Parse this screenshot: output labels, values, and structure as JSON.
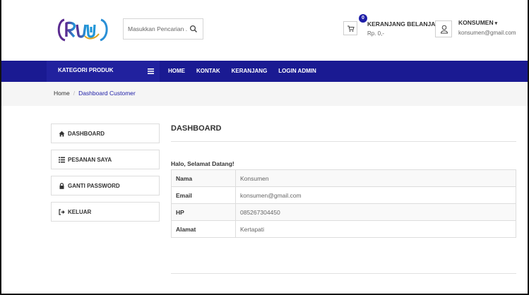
{
  "header": {
    "search": {
      "placeholder": "Masukkan Pencarian .."
    },
    "cart": {
      "badge": "0",
      "title": "KERANJANG BELANJA :",
      "total": "Rp. 0,-"
    },
    "user": {
      "name": "KONSUMEN",
      "email": "konsumen@gmail.com"
    }
  },
  "nav": {
    "kategori": "KATEGORI PRODUK",
    "links": [
      "HOME",
      "KONTAK",
      "KERANJANG",
      "LOGIN ADMIN"
    ]
  },
  "breadcrumb": {
    "home": "Home",
    "current": "Dashboard Customer"
  },
  "sidebar": {
    "items": [
      {
        "label": "DASHBOARD",
        "icon": "home-icon"
      },
      {
        "label": "PESANAN SAYA",
        "icon": "list-icon"
      },
      {
        "label": "GANTI PASSWORD",
        "icon": "lock-icon"
      },
      {
        "label": "KELUAR",
        "icon": "sign-out-icon"
      }
    ]
  },
  "main": {
    "title": "DASHBOARD",
    "greeting": "Halo, Selamat Datang!",
    "rows": [
      {
        "key": "Nama",
        "value": "Konsumen"
      },
      {
        "key": "Email",
        "value": "konsumen@gmail.com"
      },
      {
        "key": "HP",
        "value": "085267304450"
      },
      {
        "key": "Alamat",
        "value": "Kertapati"
      }
    ]
  },
  "colors": {
    "navbar": "#1a1a92",
    "accent": "#1f1fa8",
    "breadcrumb_bg": "#f5f5f5"
  }
}
